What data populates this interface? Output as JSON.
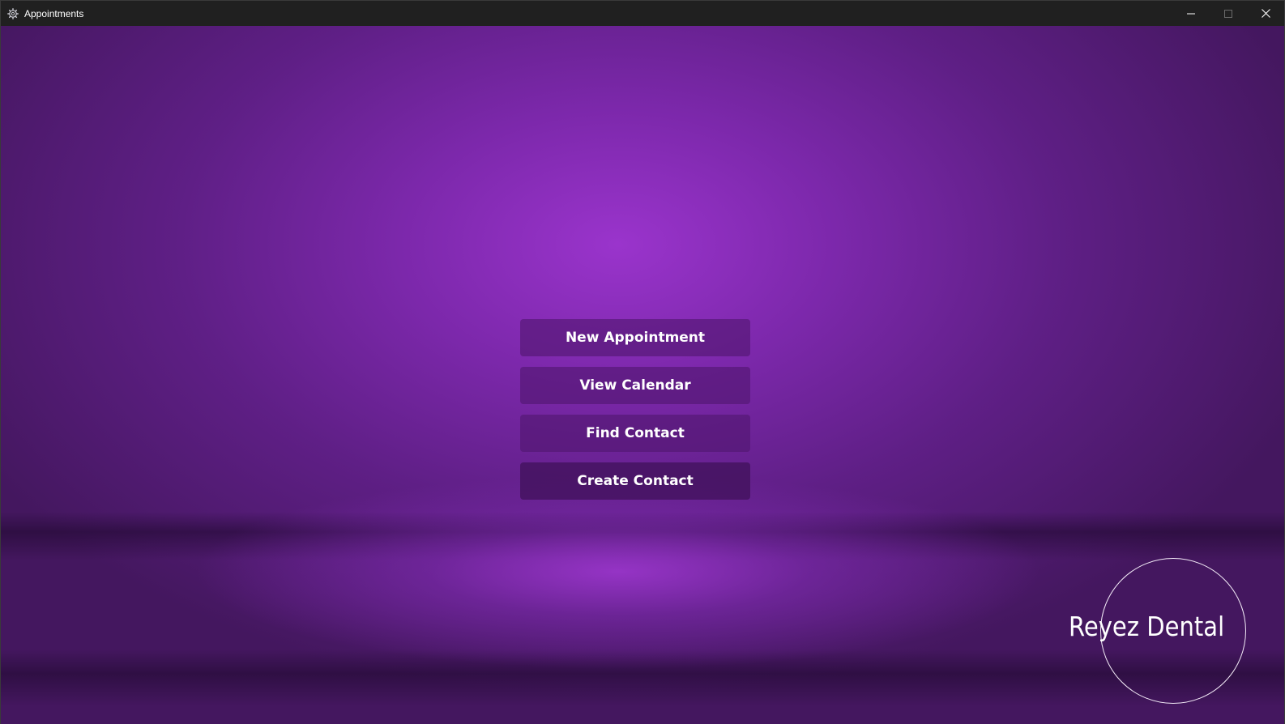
{
  "window": {
    "title": "Appointments",
    "app_icon": "gear-icon",
    "controls": {
      "minimize_icon": "minimize-icon",
      "maximize_icon": "maximize-icon",
      "close_icon": "close-icon"
    }
  },
  "menu": {
    "buttons": [
      {
        "label": "New Appointment"
      },
      {
        "label": "View Calendar"
      },
      {
        "label": "Find Contact"
      },
      {
        "label": "Create Contact"
      }
    ]
  },
  "logo": {
    "text": "Reyez Dental"
  },
  "colors": {
    "background_center": "#9a34cc",
    "background_edge": "#44175f",
    "button_fill": "#501670",
    "button_text": "#ffffff",
    "titlebar": "#202020"
  }
}
